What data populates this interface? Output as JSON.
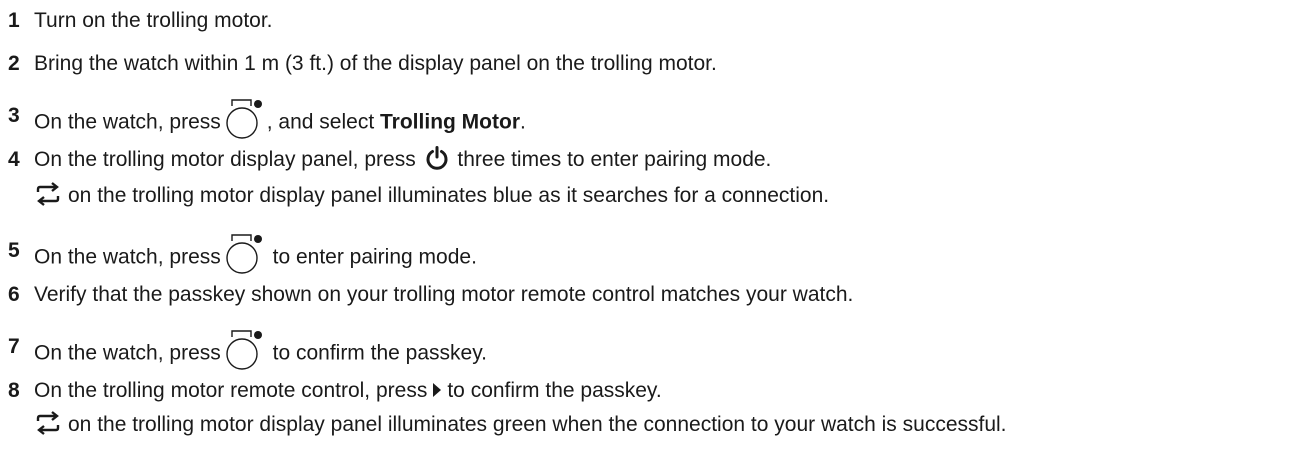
{
  "steps": [
    {
      "number": "1",
      "text": "Turn on the trolling motor."
    },
    {
      "number": "2",
      "text": "Bring the watch within 1 m (3 ft.) of the display panel on the trolling motor."
    },
    {
      "number": "3",
      "pre": "On the watch, press",
      "post": ", and select",
      "bold": "Trolling Motor",
      "end": "."
    },
    {
      "number": "4",
      "pre": "On the trolling motor display panel, press",
      "post": "three times to enter pairing mode.",
      "note": "on the trolling motor display panel illuminates blue as it searches for a connection."
    },
    {
      "number": "5",
      "pre": "On the watch, press",
      "post": "to enter pairing mode."
    },
    {
      "number": "6",
      "text": "Verify that the passkey shown on your trolling motor remote control matches your watch."
    },
    {
      "number": "7",
      "pre": "On the watch, press",
      "post": "to confirm the passkey."
    },
    {
      "number": "8",
      "pre": "On the trolling motor remote control, press",
      "post": "to confirm the passkey.",
      "note": "on the trolling motor display panel illuminates green when the connection to your watch is successful."
    }
  ],
  "icons": {
    "watch_button": "watch-button-icon",
    "power": "power-icon",
    "sync": "sync-icon",
    "forward": "forward-arrow-icon"
  }
}
